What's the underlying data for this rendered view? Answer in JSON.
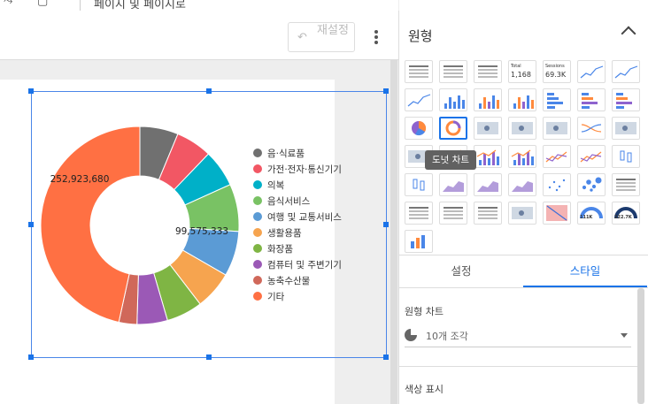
{
  "toolbar": {
    "top_text": "페이지 및 페이지로",
    "reset_label": "재설정"
  },
  "chart": {
    "label_outer": "252,923,680",
    "label_inner": "99,575,333"
  },
  "chart_data": {
    "type": "pie",
    "donut": true,
    "categories": [
      "음·식료품",
      "가전·전자·통신기기",
      "의복",
      "음식서비스",
      "여행 및 교통서비스",
      "생활용품",
      "화장품",
      "컴퓨터 및 주변기기",
      "농축수산물",
      "기타"
    ],
    "values": [
      34000000,
      32000000,
      33000000,
      42000000,
      40000000,
      34000000,
      32000000,
      27000000,
      16000000,
      252923680
    ],
    "colors": [
      "#707070",
      "#f25764",
      "#00b0c8",
      "#79c264",
      "#5b9bd5",
      "#f6a44f",
      "#7fb544",
      "#9b59b6",
      "#d0685a",
      "#ff7043"
    ],
    "data_labels": [
      "252,923,680",
      "99,575,333"
    ],
    "legend_position": "right"
  },
  "panel": {
    "title": "원형",
    "tooltip": "도넛 차트",
    "tabs": [
      "설정",
      "스타일"
    ],
    "sections": {
      "pie_chart_label": "원형 차트",
      "slices_value": "10개 조각",
      "color_label": "색상 표시"
    },
    "tiles": {
      "total_label": "Total",
      "total_value": "1,168",
      "sessions_label": "Sessions",
      "sessions_value": "69.3K",
      "gauge_value": "111K",
      "gauge_value2": "222.7K"
    }
  }
}
